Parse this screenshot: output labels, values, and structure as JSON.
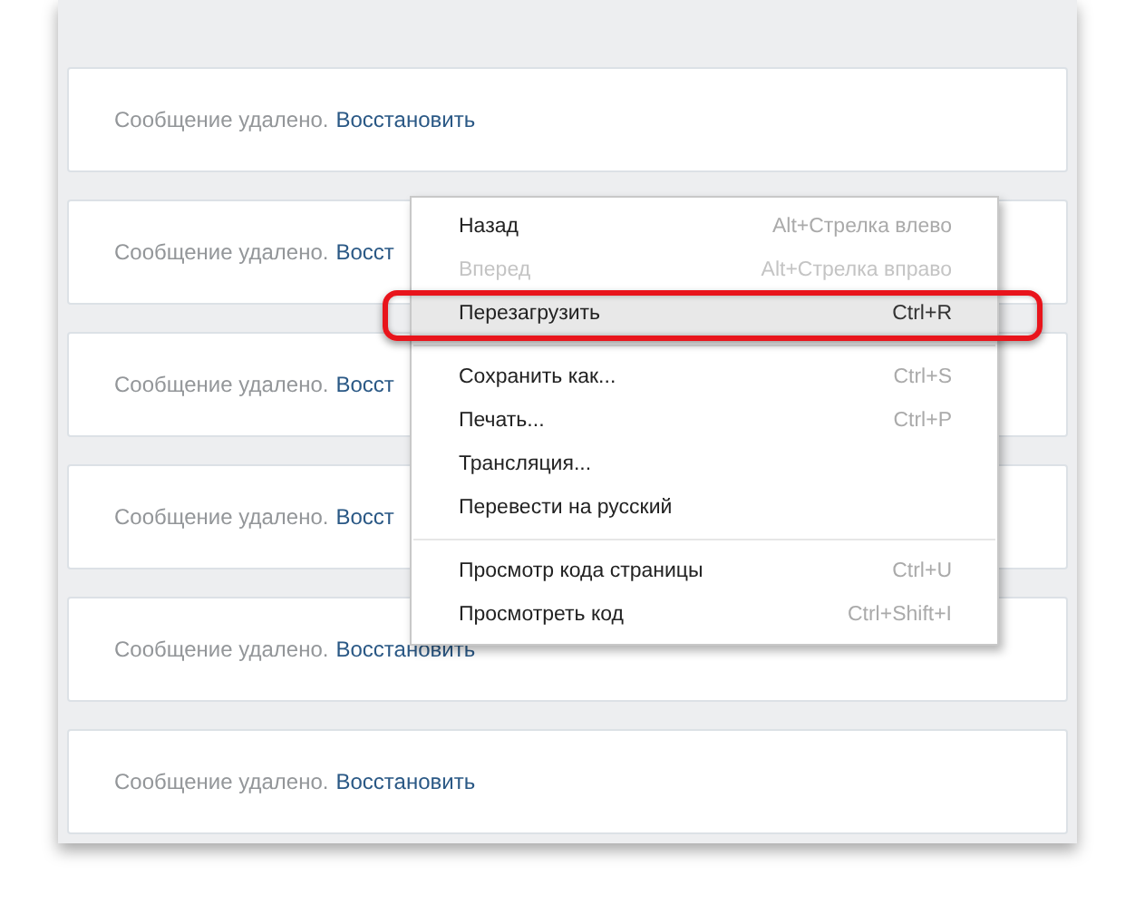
{
  "messages": [
    {
      "text": "Сообщение удалено.",
      "link": "Восстановить"
    },
    {
      "text": "Сообщение удалено.",
      "link": "Восст"
    },
    {
      "text": "Сообщение удалено.",
      "link": "Восст"
    },
    {
      "text": "Сообщение удалено.",
      "link": "Восст"
    },
    {
      "text": "Сообщение удалено.",
      "link": "Восстановить"
    },
    {
      "text": "Сообщение удалено.",
      "link": "Восстановить"
    }
  ],
  "context_menu": {
    "items": [
      {
        "kind": "item",
        "label": "Назад",
        "shortcut": "Alt+Стрелка влево",
        "disabled": false,
        "highlighted": false
      },
      {
        "kind": "item",
        "label": "Вперед",
        "shortcut": "Alt+Стрелка вправо",
        "disabled": true,
        "highlighted": false
      },
      {
        "kind": "item",
        "label": "Перезагрузить",
        "shortcut": "Ctrl+R",
        "disabled": false,
        "highlighted": true
      },
      {
        "kind": "separator"
      },
      {
        "kind": "item",
        "label": "Сохранить как...",
        "shortcut": "Ctrl+S",
        "disabled": false,
        "highlighted": false
      },
      {
        "kind": "item",
        "label": "Печать...",
        "shortcut": "Ctrl+P",
        "disabled": false,
        "highlighted": false
      },
      {
        "kind": "item",
        "label": "Трансляция...",
        "disabled": false,
        "highlighted": false
      },
      {
        "kind": "item",
        "label": "Перевести на русский",
        "disabled": false,
        "highlighted": false
      },
      {
        "kind": "separator"
      },
      {
        "kind": "item",
        "label": "Просмотр кода страницы",
        "shortcut": "Ctrl+U",
        "disabled": false,
        "highlighted": false
      },
      {
        "kind": "item",
        "label": "Просмотреть код",
        "shortcut": "Ctrl+Shift+I",
        "disabled": false,
        "highlighted": false
      }
    ]
  }
}
